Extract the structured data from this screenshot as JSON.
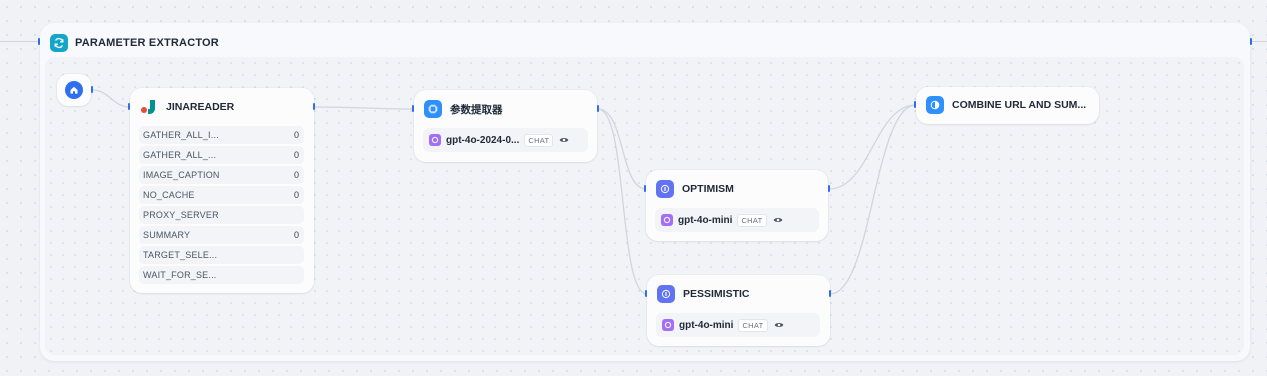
{
  "iteration": {
    "title": "PARAMETER EXTRACTOR",
    "icon": "loop-icon"
  },
  "start_node": {
    "icon": "home-icon"
  },
  "jina_node": {
    "title": "JINAREADER",
    "icon": "jina-logo-icon",
    "params": [
      {
        "key": "GATHER_ALL_I...",
        "value": "0"
      },
      {
        "key": "GATHER_ALL_...",
        "value": "0"
      },
      {
        "key": "IMAGE_CAPTION",
        "value": "0"
      },
      {
        "key": "NO_CACHE",
        "value": "0"
      },
      {
        "key": "PROXY_SERVER",
        "value": ""
      },
      {
        "key": "SUMMARY",
        "value": "0"
      },
      {
        "key": "TARGET_SELE...",
        "value": ""
      },
      {
        "key": "WAIT_FOR_SE...",
        "value": ""
      }
    ]
  },
  "extractor_node": {
    "title": "参数提取器",
    "model": "gpt-4o-2024-0...",
    "badge": "CHAT"
  },
  "optimism_node": {
    "title": "OPTIMISM",
    "model": "gpt-4o-mini",
    "badge": "CHAT"
  },
  "pessimistic_node": {
    "title": "PESSIMISTIC",
    "model": "gpt-4o-mini",
    "badge": "CHAT"
  },
  "combine_node": {
    "title": "COMBINE URL AND SUM..."
  },
  "colors": {
    "handle": "#2d6ff0",
    "edge": "#d0d5dd",
    "llm_icon": "#6172f3",
    "model_icon": "#a26ff6",
    "extractor_icon": "#2e90fa",
    "combine_icon": "#2e90fa",
    "iteration_icon": "#14a5c9"
  }
}
